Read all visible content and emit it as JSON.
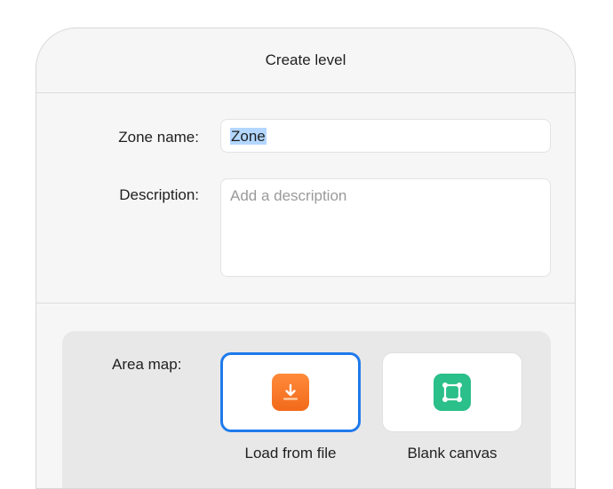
{
  "dialog": {
    "title": "Create level"
  },
  "form": {
    "zone_name_label": "Zone name:",
    "zone_name_value": "Zone",
    "description_label": "Description:",
    "description_placeholder": "Add a description"
  },
  "area_map": {
    "label": "Area map:",
    "options": [
      {
        "label": "Load from file",
        "icon": "download-icon",
        "selected": true,
        "accent": "#f26a1b"
      },
      {
        "label": "Blank canvas",
        "icon": "blank-canvas-icon",
        "selected": false,
        "accent": "#2bbf8a"
      }
    ],
    "selection_color": "#1f7aec"
  }
}
